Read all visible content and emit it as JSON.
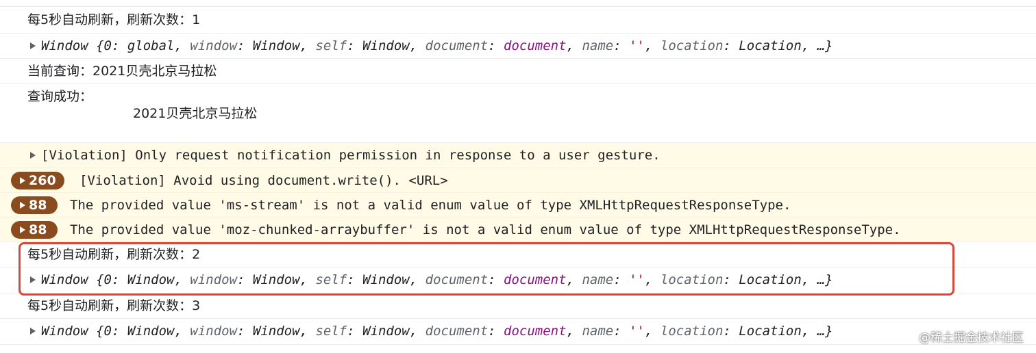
{
  "console": {
    "rows": [
      {
        "text": "每5秒自动刷新，刷新次数：1"
      },
      {
        "window": {
          "prefix": "Window {",
          "k0": "0",
          "v0": "global",
          "k1": "window",
          "v1": "Window",
          "k2": "self",
          "v2": "Window",
          "k3": "document",
          "v3": "document",
          "k4": "name",
          "v4": "''",
          "k5": "location",
          "v5": "Location",
          "suffix": "…}"
        }
      },
      {
        "text": "当前查询：2021贝壳北京马拉松"
      },
      {
        "text": "查询成功：",
        "detail": "2021贝壳北京马拉松"
      },
      {
        "text": "[Violation] Only request notification permission in response to a user gesture."
      },
      {
        "count": "260",
        "text": "[Violation] Avoid using document.write(). <URL>"
      },
      {
        "count": "88",
        "text": "The provided value 'ms-stream' is not a valid enum value of type XMLHttpRequestResponseType."
      },
      {
        "count": "88",
        "text": "The provided value 'moz-chunked-arraybuffer' is not a valid enum value of type XMLHttpRequestResponseType."
      },
      {
        "text": "每5秒自动刷新，刷新次数：2"
      },
      {
        "window": {
          "prefix": "Window {",
          "k0": "0",
          "v0": "Window",
          "k1": "window",
          "v1": "Window",
          "k2": "self",
          "v2": "Window",
          "k3": "document",
          "v3": "document",
          "k4": "name",
          "v4": "''",
          "k5": "location",
          "v5": "Location",
          "suffix": "…}"
        }
      },
      {
        "text": "每5秒自动刷新，刷新次数：3"
      },
      {
        "window": {
          "prefix": "Window {",
          "k0": "0",
          "v0": "Window",
          "k1": "window",
          "v1": "Window",
          "k2": "self",
          "v2": "Window",
          "k3": "document",
          "v3": "document",
          "k4": "name",
          "v4": "''",
          "k5": "location",
          "v5": "Location",
          "suffix": "…}"
        }
      }
    ]
  },
  "watermark": "@稀土掘金技术社区",
  "colors": {
    "highlight": "#e0453a",
    "badge": "#8a4b1e",
    "warning_bg": "#fffbe6",
    "document_value": "#881280",
    "string_value": "#c80000"
  }
}
